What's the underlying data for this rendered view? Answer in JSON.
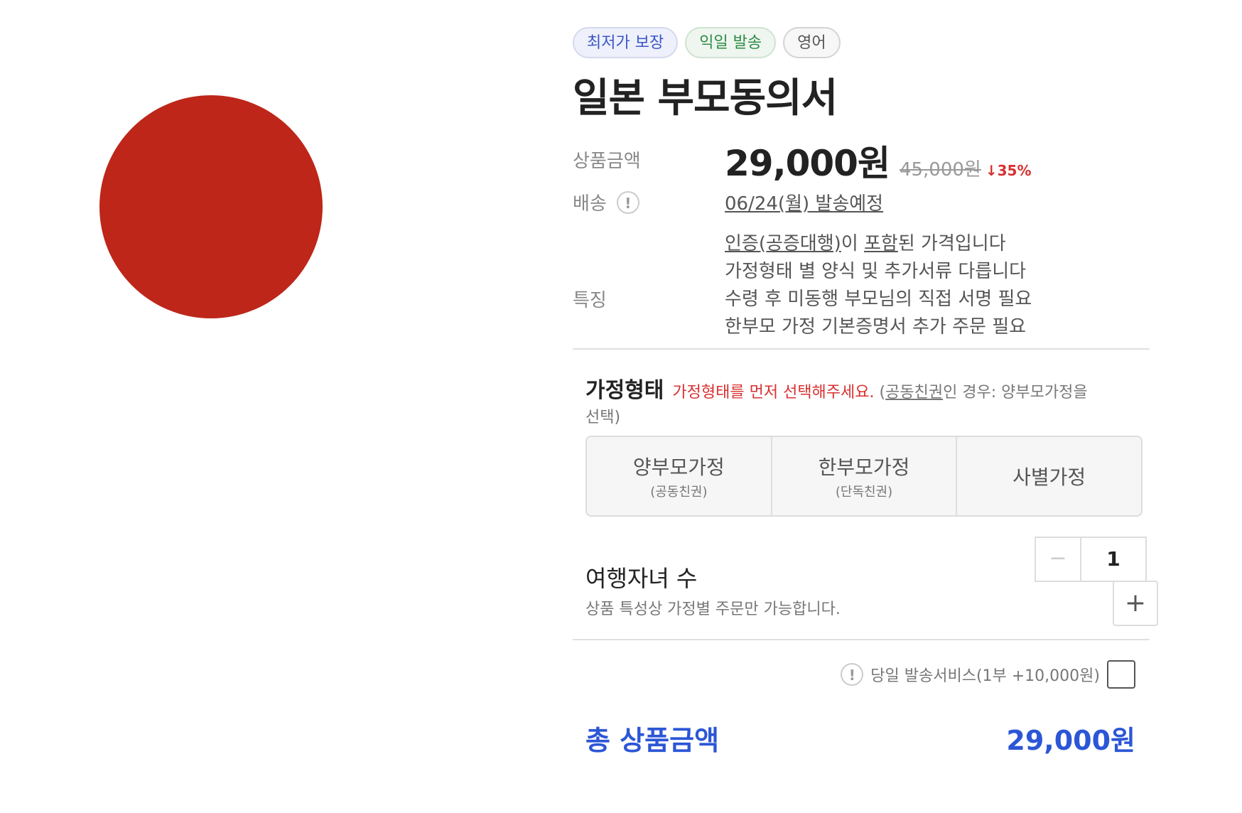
{
  "badges": [
    "최저가 보장",
    "익일 발송",
    "영어"
  ],
  "title": "일본 부모동의서",
  "price": {
    "label": "상품금액",
    "current": "29,000원",
    "original": "45,000원",
    "discount": "↓35%"
  },
  "shipping": {
    "label": "배송",
    "info_icon": "!",
    "value": "06/24(월) 발송예정"
  },
  "features": {
    "label": "특징",
    "line1_link1": "인증(공증대행)",
    "line1_mid": "이 ",
    "line1_link2": "포함",
    "line1_end": "된 가격입니다",
    "line2": "가정형태 별 양식 및 추가서류 다릅니다",
    "line3": "수령 후 미동행 부모님의 직접 서명 필요",
    "line4": "한부모 가정 기본증명서 추가 주문 필요"
  },
  "family": {
    "title": "가정형태",
    "warning": "가정형태를 먼저 선택해주세요.",
    "note_open": " (",
    "note_link": "공동친권",
    "note_rest": "인 경우: 양부모가정을",
    "note_line2": "선택)",
    "options": [
      {
        "main": "양부모가정",
        "sub": "(공동친권)"
      },
      {
        "main": "한부모가정",
        "sub": "(단독친권)"
      },
      {
        "main": "사별가정",
        "sub": ""
      }
    ]
  },
  "kids": {
    "title": "여행자녀 수",
    "note": "상품 특성상 가정별 주문만 가능합니다.",
    "quantity": "1",
    "minus": "−",
    "plus": "+"
  },
  "sameday": {
    "info_icon": "!",
    "label": "당일 발송서비스(1부 +10,000원)"
  },
  "total": {
    "label": "총 상품금액",
    "value": "29,000원"
  },
  "colors": {
    "flag_red": "#bd2619",
    "accent_blue": "#2c56d6",
    "warning_red": "#d93030"
  }
}
